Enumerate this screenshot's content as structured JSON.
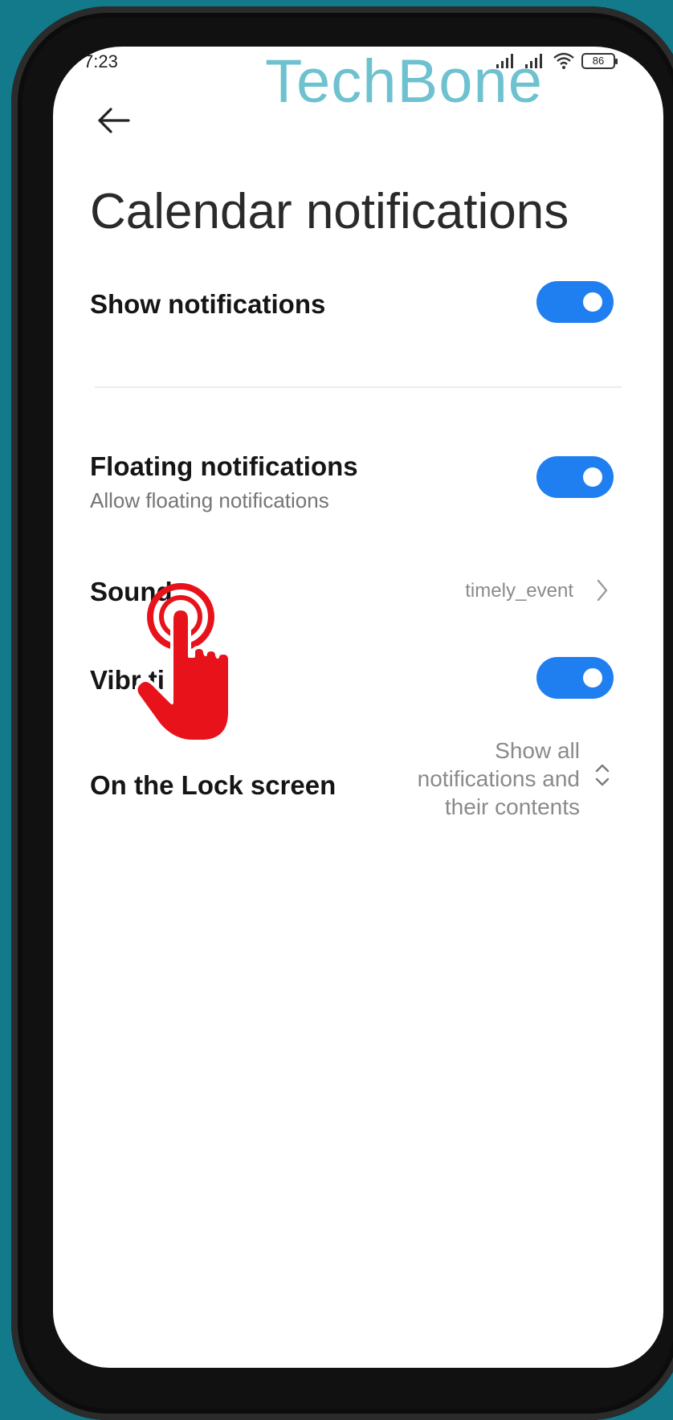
{
  "status_bar": {
    "time": "7:23",
    "battery": "86"
  },
  "watermark": "TechBone",
  "header": {
    "title": "Calendar notifications"
  },
  "settings": {
    "show_notifications": {
      "label": "Show notifications",
      "enabled": true
    },
    "floating_notifications": {
      "label": "Floating notifications",
      "sublabel": "Allow floating notifications",
      "enabled": true
    },
    "sound": {
      "label": "Sound",
      "value": "timely_event"
    },
    "vibrate": {
      "label": "Vibr ti",
      "enabled": true
    },
    "lock_screen": {
      "label": "On the Lock screen",
      "value_lines": [
        "Show all",
        "notifications and",
        "their contents"
      ]
    }
  },
  "colors": {
    "background": "#127a8a",
    "toggle_on": "#1f7ef0",
    "watermark": "#6ec2cf",
    "tap_hand": "#e8121b"
  },
  "icons": {
    "back": "arrow-left-icon",
    "sound_chevron": "chevron-right-icon",
    "lock_screen_selector": "chevron-up-down-icon",
    "tap_indicator": "tap-hand-icon"
  }
}
